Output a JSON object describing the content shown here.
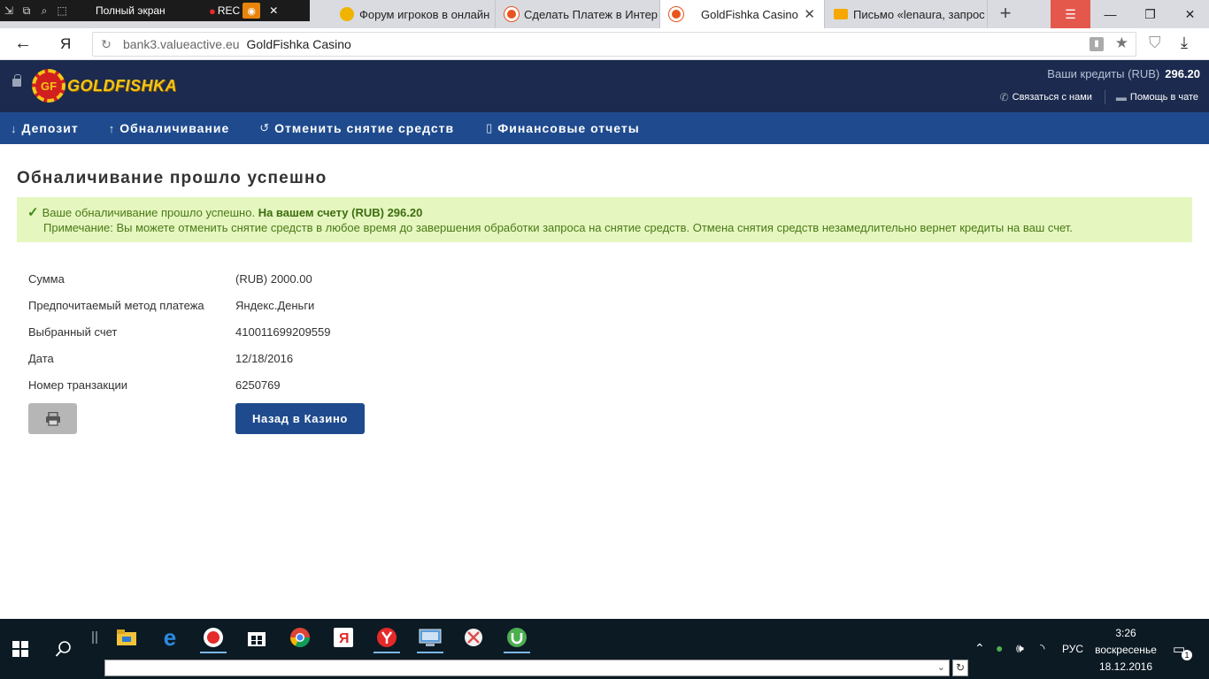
{
  "recorder": {
    "fullscreen_label": "Полный экран",
    "rec_label": "REC"
  },
  "tabs": [
    {
      "label": "Форум игроков в онлайн",
      "favicon_color": "#f0b400",
      "active": false
    },
    {
      "label": "Сделать Платеж в Интер",
      "favicon_color": "#e8541e",
      "active": false
    },
    {
      "label": "GoldFishka Casino",
      "favicon_color": "#e8541e",
      "active": true
    },
    {
      "label": "Письмо «lenaura, запрос",
      "favicon_color": "#f6a800",
      "active": false
    }
  ],
  "address_bar": {
    "yandex_logo": "Я",
    "host": "bank3.valueactive.eu",
    "page_title": "GoldFishka Casino"
  },
  "site": {
    "logo_text": "GOLDFISHKA",
    "logo_chip_text": "GF",
    "credits_label": "Ваши кредиты (RUB)",
    "credits_value": "296.20",
    "contact_label": "Связаться с нами",
    "chat_label": "Помощь в чате",
    "brand_colors": {
      "header_bg": "#1b2a4e",
      "nav_bg": "#1f4b8e",
      "logo_gold": "#f5c518"
    }
  },
  "nav": [
    {
      "label": "Депозит",
      "icon": "arrow-down-icon"
    },
    {
      "label": "Обналичивание",
      "icon": "arrow-up-icon"
    },
    {
      "label": "Отменить снятие средств",
      "icon": "history-icon"
    },
    {
      "label": "Финансовые отчеты",
      "icon": "document-icon"
    }
  ],
  "page": {
    "title": "Обналичивание прошло успешно",
    "alert": {
      "message": "Ваше обналичивание прошло успешно.",
      "balance_text": "На вашем счету (RUB) 296.20",
      "note": "Примечание: Вы можете отменить снятие средств в любое время до завершения обработки запроса на снятие средств. Отмена снятия средств незамедлительно вернет кредиты на ваш счет."
    },
    "details": [
      {
        "label": "Сумма",
        "value": "(RUB) 2000.00"
      },
      {
        "label": "Предпочитаемый метод платежа",
        "value": "Яндекс.Деньги"
      },
      {
        "label": "Выбранный счет",
        "value": "410011699209559"
      },
      {
        "label": "Дата",
        "value": "12/18/2016"
      },
      {
        "label": "Номер транзакции",
        "value": "6250769"
      }
    ],
    "back_button": "Назад в Казино"
  },
  "taskbar": {
    "apps": [
      {
        "name": "file-explorer-icon",
        "color": "#f3c33a",
        "running": false
      },
      {
        "name": "edge-icon",
        "color": "#2c8be0",
        "running": false
      },
      {
        "name": "recorder-icon",
        "color": "#e52a2a",
        "running": true
      },
      {
        "name": "store-icon",
        "color": "#ffffff",
        "running": false
      },
      {
        "name": "chrome-icon",
        "color": "#4caf50",
        "running": false
      },
      {
        "name": "yandex-icon",
        "color": "#e52a2a",
        "running": false
      },
      {
        "name": "yandex-browser-icon",
        "color": "#e52a2a",
        "running": true
      },
      {
        "name": "remote-desktop-icon",
        "color": "#5b9bd5",
        "running": true
      },
      {
        "name": "snipping-tool-icon",
        "color": "#e04b4b",
        "running": false
      },
      {
        "name": "utorrent-icon",
        "color": "#4caf50",
        "running": true
      }
    ],
    "language": "РУС",
    "time": "3:26",
    "weekday": "воскресенье",
    "date": "18.12.2016",
    "notification_count": "1"
  }
}
